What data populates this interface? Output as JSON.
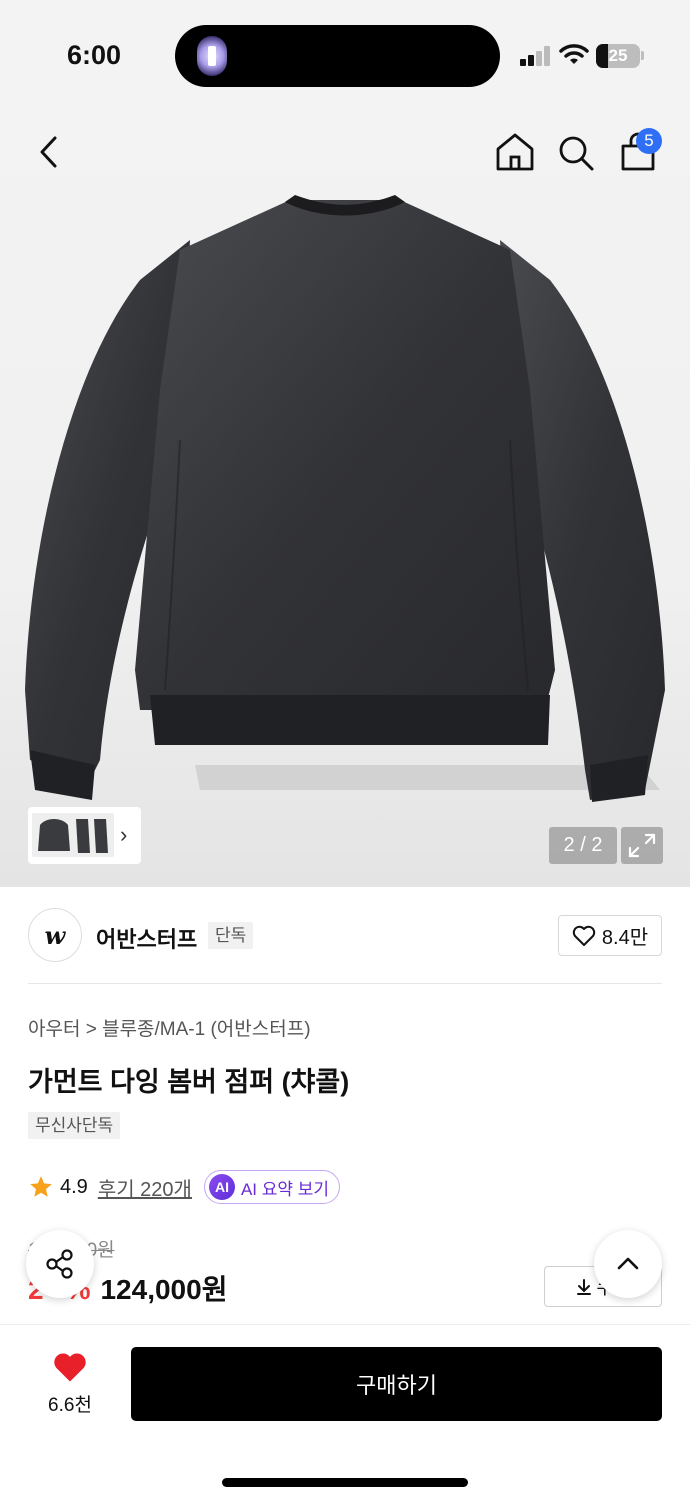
{
  "status": {
    "time": "6:00",
    "battery": "25"
  },
  "nav": {
    "cart_count": "5"
  },
  "gallery": {
    "page": "2 / 2"
  },
  "brand": {
    "logo_text": "w",
    "name": "어반스터프",
    "tag": "단독",
    "likes": "8.4만"
  },
  "product": {
    "breadcrumb": "아우터 > 블루종/MA-1 (어반스터프)",
    "title": "가먼트 다잉 봄버 점퍼 (챠콜)",
    "exclusive": "무신사단독",
    "rating": "4.9",
    "review_link": "후기 220개",
    "ai_badge": "AI",
    "ai_label": "AI 요약 보기",
    "original_price": "1",
    "original_price_tail": "0원",
    "discount": "2",
    "discount_tail": "%",
    "sale_price": "124,000원",
    "coupon_label": "쿠폰"
  },
  "bottom": {
    "wish_count": "6.6천",
    "buy_label": "구매하기"
  },
  "colors": {
    "accent_blue": "#2f6ff6",
    "sale_red": "#f23b3b",
    "star": "#f7a21b",
    "heart": "#e8202a",
    "ai_purple": "#6a2bd6"
  }
}
